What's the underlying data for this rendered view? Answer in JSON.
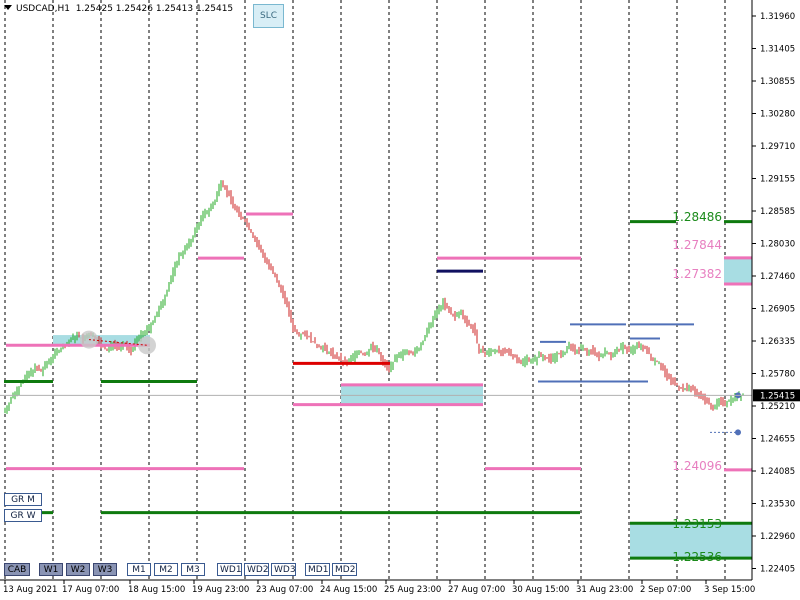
{
  "header": {
    "symbol_timeframe": "USDCAD,H1",
    "ohlc": "1.25425 1.25426 1.25413 1.25415"
  },
  "slc_label": "SLC",
  "price_axis": [
    "1.31960",
    "1.31405",
    "1.30855",
    "1.30280",
    "1.29710",
    "1.29155",
    "1.28585",
    "1.28030",
    "1.27460",
    "1.26905",
    "1.26335",
    "1.25780",
    "1.25210",
    "1.24655",
    "1.24085",
    "1.23530",
    "1.22960",
    "1.22405"
  ],
  "current_price": "1.25415",
  "time_axis": [
    "13 Aug 2021",
    "17 Aug 07:00",
    "18 Aug 15:00",
    "19 Aug 23:00",
    "23 Aug 07:00",
    "24 Aug 15:00",
    "25 Aug 23:00",
    "27 Aug 07:00",
    "30 Aug 15:00",
    "31 Aug 23:00",
    "2 Sep 07:00",
    "3 Sep 15:00"
  ],
  "level_labels": [
    {
      "text": "1.28486",
      "color": "#1a8a1a"
    },
    {
      "text": "1.27844",
      "color": "#e77fc0"
    },
    {
      "text": "1.27382",
      "color": "#e77fc0"
    },
    {
      "text": "1.24096",
      "color": "#e77fc0"
    },
    {
      "text": "1.23153",
      "color": "#1a8a1a"
    },
    {
      "text": "1.22536",
      "color": "#1a8a1a"
    }
  ],
  "side_buttons": [
    "GR M",
    "GR W"
  ],
  "bottom_buttons": {
    "cab": "CAB",
    "weeks": [
      "W1",
      "W2",
      "W3"
    ],
    "months": [
      "M1",
      "M2",
      "M3"
    ],
    "wd": [
      "WD1",
      "WD2",
      "WD3"
    ],
    "md": [
      "MD1",
      "MD2"
    ]
  },
  "colors": {
    "bull": "#22aa22",
    "bear": "#cc2222",
    "green_level": "#0e7a0e",
    "pink_level": "#ee72b8",
    "red_level": "#dd0000",
    "navy_level": "#101060",
    "blue_level": "#5070b8",
    "zone_fill": "#a8dde3"
  },
  "chart_data": {
    "type": "candlestick",
    "symbol": "USDCAD",
    "timeframe": "H1",
    "y_range": [
      1.2215,
      1.3205
    ],
    "close_path": [
      [
        0,
        1.2515
      ],
      [
        6,
        1.2535
      ],
      [
        12,
        1.2552
      ],
      [
        18,
        1.2568
      ],
      [
        24,
        1.258
      ],
      [
        30,
        1.259
      ],
      [
        36,
        1.2584
      ],
      [
        42,
        1.2598
      ],
      [
        48,
        1.2612
      ],
      [
        54,
        1.2622
      ],
      [
        60,
        1.2628
      ],
      [
        66,
        1.264
      ],
      [
        72,
        1.2648
      ],
      [
        78,
        1.264
      ],
      [
        84,
        1.265
      ],
      [
        90,
        1.2645
      ],
      [
        96,
        1.263
      ],
      [
        102,
        1.262
      ],
      [
        108,
        1.2634
      ],
      [
        114,
        1.2626
      ],
      [
        120,
        1.263
      ],
      [
        126,
        1.262
      ],
      [
        132,
        1.264
      ],
      [
        138,
        1.2652
      ],
      [
        144,
        1.266
      ],
      [
        150,
        1.268
      ],
      [
        156,
        1.27
      ],
      [
        162,
        1.2728
      ],
      [
        168,
        1.276
      ],
      [
        174,
        1.2788
      ],
      [
        180,
        1.28
      ],
      [
        186,
        1.2815
      ],
      [
        192,
        1.284
      ],
      [
        198,
        1.286
      ],
      [
        204,
        1.287
      ],
      [
        210,
        1.2885
      ],
      [
        216,
        1.2922
      ],
      [
        222,
        1.29
      ],
      [
        228,
        1.288
      ],
      [
        234,
        1.2862
      ],
      [
        240,
        1.285
      ],
      [
        246,
        1.283
      ],
      [
        252,
        1.2808
      ],
      [
        258,
        1.279
      ],
      [
        264,
        1.277
      ],
      [
        270,
        1.275
      ],
      [
        276,
        1.273
      ],
      [
        282,
        1.27
      ],
      [
        288,
        1.266
      ],
      [
        294,
        1.265
      ],
      [
        300,
        1.2652
      ],
      [
        306,
        1.264
      ],
      [
        312,
        1.263
      ],
      [
        318,
        1.2625
      ],
      [
        324,
        1.2618
      ],
      [
        330,
        1.2612
      ],
      [
        336,
        1.2602
      ],
      [
        342,
        1.2598
      ],
      [
        348,
        1.261
      ],
      [
        354,
        1.262
      ],
      [
        360,
        1.2612
      ],
      [
        366,
        1.2628
      ],
      [
        372,
        1.2622
      ],
      [
        378,
        1.26
      ],
      [
        384,
        1.259
      ],
      [
        390,
        1.2605
      ],
      [
        396,
        1.2612
      ],
      [
        402,
        1.2622
      ],
      [
        408,
        1.2615
      ],
      [
        414,
        1.2625
      ],
      [
        420,
        1.2645
      ],
      [
        426,
        1.267
      ],
      [
        432,
        1.269
      ],
      [
        438,
        1.2705
      ],
      [
        444,
        1.269
      ],
      [
        450,
        1.268
      ],
      [
        456,
        1.2688
      ],
      [
        462,
        1.267
      ],
      [
        468,
        1.266
      ],
      [
        474,
        1.2622
      ],
      [
        480,
        1.2615
      ],
      [
        486,
        1.262
      ],
      [
        492,
        1.2622
      ],
      [
        498,
        1.2615
      ],
      [
        504,
        1.2618
      ],
      [
        510,
        1.261
      ],
      [
        516,
        1.2598
      ],
      [
        522,
        1.2608
      ],
      [
        528,
        1.2602
      ],
      [
        534,
        1.2612
      ],
      [
        540,
        1.261
      ],
      [
        546,
        1.2605
      ],
      [
        552,
        1.2615
      ],
      [
        558,
        1.2612
      ],
      [
        564,
        1.263
      ],
      [
        570,
        1.2618
      ],
      [
        576,
        1.2625
      ],
      [
        582,
        1.2618
      ],
      [
        588,
        1.2622
      ],
      [
        594,
        1.261
      ],
      [
        600,
        1.2618
      ],
      [
        606,
        1.2612
      ],
      [
        612,
        1.262
      ],
      [
        618,
        1.2628
      ],
      [
        624,
        1.262
      ],
      [
        630,
        1.2626
      ],
      [
        636,
        1.263
      ],
      [
        642,
        1.262
      ],
      [
        648,
        1.2605
      ],
      [
        654,
        1.26
      ],
      [
        660,
        1.258
      ],
      [
        666,
        1.2568
      ],
      [
        672,
        1.256
      ],
      [
        678,
        1.2552
      ],
      [
        684,
        1.2556
      ],
      [
        690,
        1.2548
      ],
      [
        696,
        1.254
      ],
      [
        702,
        1.253
      ],
      [
        708,
        1.252
      ],
      [
        714,
        1.253
      ],
      [
        720,
        1.2528
      ],
      [
        726,
        1.2536
      ],
      [
        732,
        1.254
      ],
      [
        738,
        1.25415
      ]
    ],
    "levels": [
      {
        "price": 1.263,
        "color": "pink",
        "x": [
          6,
          150
        ]
      },
      {
        "price": 1.2566,
        "color": "green",
        "x": [
          4,
          53
        ]
      },
      {
        "price": 1.2566,
        "color": "green",
        "x": [
          101,
          197
        ]
      },
      {
        "price": 1.2784,
        "color": "pink",
        "x": [
          198,
          244
        ]
      },
      {
        "price": 1.2862,
        "color": "pink",
        "x": [
          246,
          293
        ]
      },
      {
        "price": 1.2598,
        "color": "red",
        "x": [
          293,
          390
        ]
      },
      {
        "price": 1.256,
        "color": "pink",
        "x": [
          341,
          483
        ]
      },
      {
        "price": 1.2525,
        "color": "pink",
        "x": [
          293,
          483
        ]
      },
      {
        "price": 1.2784,
        "color": "pink",
        "x": [
          437,
          581
        ]
      },
      {
        "price": 1.2761,
        "color": "navy",
        "x": [
          437,
          483
        ]
      },
      {
        "price": 1.2412,
        "color": "pink",
        "x": [
          6,
          244
        ]
      },
      {
        "price": 1.2412,
        "color": "pink",
        "x": [
          485,
          581
        ]
      },
      {
        "price": 1.2334,
        "color": "green",
        "x": [
          4,
          53
        ]
      },
      {
        "price": 1.2334,
        "color": "green",
        "x": [
          101,
          580
        ]
      },
      {
        "price": 1.28486,
        "color": "green",
        "x": [
          630,
          676
        ]
      },
      {
        "price": 1.28486,
        "color": "green",
        "x": [
          724,
          752
        ]
      },
      {
        "price": 1.27844,
        "color": "pink",
        "x": [
          724,
          752
        ]
      },
      {
        "price": 1.27382,
        "color": "pink",
        "x": [
          724,
          752
        ]
      },
      {
        "price": 1.24096,
        "color": "pink",
        "x": [
          724,
          752
        ]
      },
      {
        "price": 1.23153,
        "color": "green",
        "x": [
          630,
          752
        ]
      },
      {
        "price": 1.22536,
        "color": "green",
        "x": [
          630,
          752
        ]
      },
      {
        "price": 1.2566,
        "color": "blue",
        "x": [
          538,
          648
        ]
      },
      {
        "price": 1.2636,
        "color": "blue",
        "x": [
          540,
          566
        ]
      },
      {
        "price": 1.2667,
        "color": "blue",
        "x": [
          570,
          626
        ]
      },
      {
        "price": 1.2667,
        "color": "blue",
        "x": [
          630,
          694
        ]
      },
      {
        "price": 1.2642,
        "color": "blue",
        "x": [
          630,
          660
        ]
      }
    ],
    "zones": [
      {
        "from": 1.263,
        "to": 1.2648,
        "x": [
          53,
          150
        ]
      },
      {
        "from": 1.2525,
        "to": 1.256,
        "x": [
          341,
          483
        ]
      },
      {
        "from": 1.27382,
        "to": 1.27844,
        "x": [
          724,
          752
        ]
      },
      {
        "from": 1.22536,
        "to": 1.23153,
        "x": [
          630,
          752
        ]
      }
    ]
  }
}
